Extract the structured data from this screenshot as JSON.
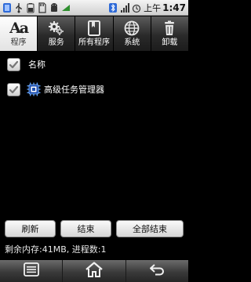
{
  "status_bar": {
    "left_icons": [
      "task-manager-app-icon",
      "usb-icon",
      "battery-charging-icon",
      "sd-card-icon",
      "android-debug-icon",
      "wifi-icon"
    ],
    "right_icons": [
      "bluetooth-icon",
      "signal-icon",
      "alarm-icon"
    ],
    "time_prefix": "上午",
    "time": "1:47"
  },
  "tabs": [
    {
      "label": "程序",
      "icon": "font-aa-icon",
      "active": true
    },
    {
      "label": "服务",
      "icon": "gears-icon",
      "active": false
    },
    {
      "label": "所有程序",
      "icon": "book-icon",
      "active": false
    },
    {
      "label": "系统",
      "icon": "globe-icon",
      "active": false
    },
    {
      "label": "卸载",
      "icon": "trash-icon",
      "active": false
    }
  ],
  "list": {
    "header": {
      "label": "名称",
      "checked": true
    },
    "items": [
      {
        "label": "高级任务管理器",
        "checked": true,
        "icon": "task-manager-chip-icon"
      }
    ]
  },
  "buttons": {
    "refresh": "刷新",
    "end": "结束",
    "end_all": "全部结束"
  },
  "memory_status": "剩余内存:41MB, 进程数:1",
  "nav": [
    {
      "icon": "menu-icon"
    },
    {
      "icon": "home-icon"
    },
    {
      "icon": "back-icon"
    }
  ],
  "colors": {
    "accent_blue": "#2e6ad8",
    "active_tab": "#f2f2f2",
    "check_green": "#777777"
  }
}
